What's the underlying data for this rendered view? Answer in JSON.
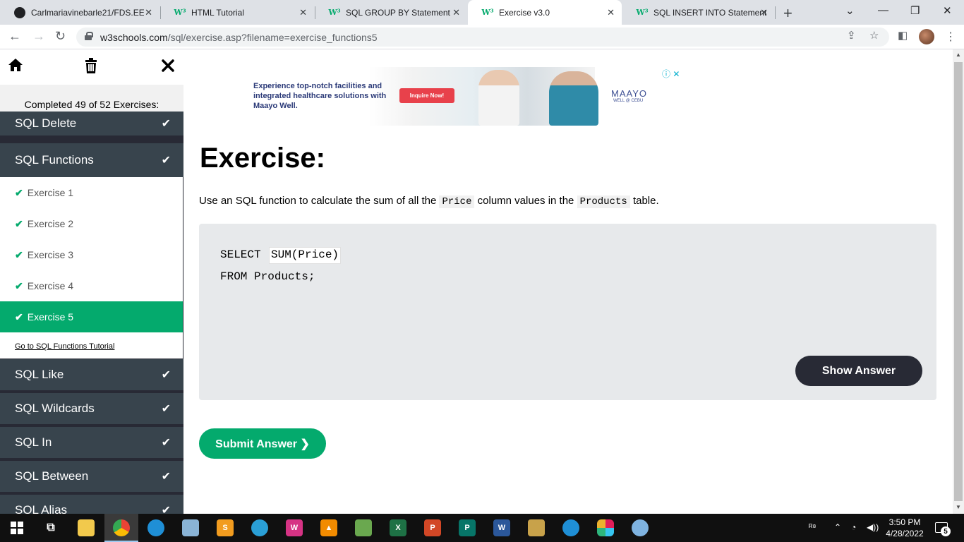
{
  "browser": {
    "tabs": [
      {
        "title": "Carlmariavinebarle21/FDS.EE",
        "favicon": "github-icon",
        "close": "✕"
      },
      {
        "title": "HTML Tutorial",
        "favicon": "w3schools-icon",
        "close": "✕"
      },
      {
        "title": "SQL GROUP BY Statement",
        "favicon": "w3schools-icon",
        "close": "✕"
      },
      {
        "title": "Exercise v3.0",
        "favicon": "w3schools-icon",
        "close": "✕",
        "active": true
      },
      {
        "title": "SQL INSERT INTO Statement",
        "favicon": "w3schools-icon",
        "close": "✕"
      }
    ],
    "new_tab": "+",
    "url_host": "w3schools.com",
    "url_path": "/sql/exercise.asp?filename=exercise_functions5"
  },
  "sidebar": {
    "completed_text": "Completed 49 of 52 Exercises:",
    "categories_above": [
      {
        "label": "SQL Delete",
        "done": true
      },
      {
        "label": "SQL Functions",
        "done": true
      }
    ],
    "exercises": [
      {
        "label": "Exercise 1"
      },
      {
        "label": "Exercise 2"
      },
      {
        "label": "Exercise 3"
      },
      {
        "label": "Exercise 4"
      },
      {
        "label": "Exercise 5",
        "active": true
      }
    ],
    "tutorial_link": "Go to SQL Functions Tutorial",
    "categories_below": [
      {
        "label": "SQL Like",
        "done": true
      },
      {
        "label": "SQL Wildcards",
        "done": true
      },
      {
        "label": "SQL In",
        "done": true
      },
      {
        "label": "SQL Between",
        "done": true
      },
      {
        "label": "SQL Alias",
        "done": true
      }
    ],
    "check_glyph": "✔"
  },
  "ad": {
    "text": "Experience top-notch facilities and integrated healthcare solutions with Maayo Well.",
    "cta": "Inquire Now!",
    "brand": "MAAYO",
    "brand_sub": "WELL @ CEBU",
    "controls": "ⓘ ✕"
  },
  "exercise": {
    "title": "Exercise:",
    "desc_before": "Use an SQL function to calculate the sum of all the ",
    "desc_code1": "Price",
    "desc_mid": " column values in the ",
    "desc_code2": "Products",
    "desc_after": " table.",
    "line1_prefix": "SELECT ",
    "line1_input": "SUM(Price)",
    "line2": "FROM Products;",
    "show_answer": "Show Answer",
    "submit": "Submit Answer ❯"
  },
  "taskbar": {
    "time": "3:50 PM",
    "date": "4/28/2022",
    "notifications": "5"
  },
  "colors": {
    "accent": "#04aa6d",
    "sidebar_bg": "#282a35",
    "sidebar_item": "#38444d",
    "code_bg": "#e7e9eb"
  }
}
